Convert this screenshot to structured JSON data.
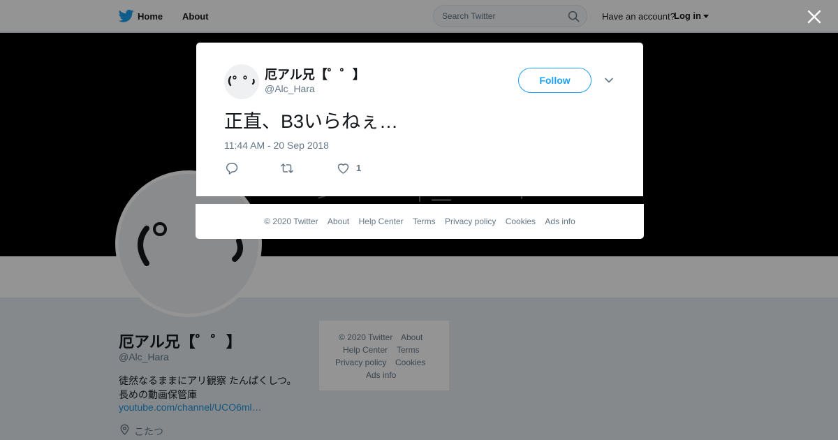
{
  "nav": {
    "home": "Home",
    "about": "About",
    "search_placeholder": "Search Twitter",
    "have_account": "Have an account?",
    "login": "Log in"
  },
  "profile": {
    "name": "厄アル兄【゜゜】",
    "handle": "@Alc_Hara",
    "bio_line1": "徒然なるままにアリ観察 たんぱくしつ。",
    "bio_line2": "長めの動画保管庫",
    "link": "youtube.com/channel/UCO6ml…",
    "location": "こたつ",
    "avatar_face": "(゜゜)"
  },
  "sidebar_footer": {
    "copyright": "© 2020 Twitter",
    "about": "About",
    "help": "Help Center",
    "terms": "Terms",
    "privacy": "Privacy policy",
    "cookies": "Cookies",
    "ads": "Ads info"
  },
  "tweet": {
    "name": "厄アル兄【゜゜】",
    "handle": "@Alc_Hara",
    "follow_label": "Follow",
    "text": "正直、B3いらねぇ…",
    "timestamp": "11:44 AM - 20 Sep 2018",
    "like_count": "1"
  },
  "modal_footer": {
    "copyright": "© 2020 Twitter",
    "about": "About",
    "help": "Help Center",
    "terms": "Terms",
    "privacy": "Privacy policy",
    "cookies": "Cookies",
    "ads": "Ads info"
  },
  "colors": {
    "accent": "#1da1f2",
    "link": "#1b95e0",
    "secondary_text": "#657786",
    "overlay": "rgba(0,0,0,0.42)"
  }
}
